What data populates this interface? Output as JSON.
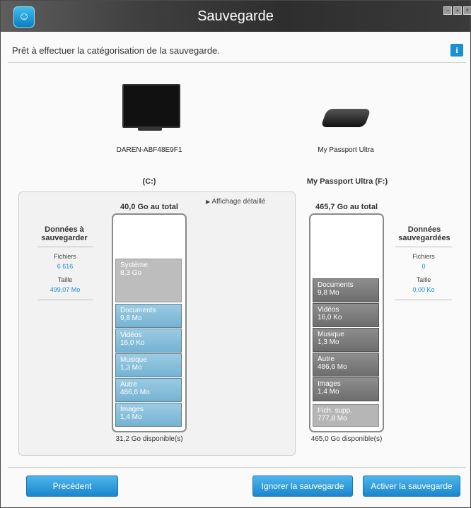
{
  "window": {
    "title": "Sauvegarde"
  },
  "status": {
    "text": "Prêt à effectuer la catégorisation de la sauvegarde."
  },
  "devices": {
    "source_name": "DAREN-ABF48E9F1",
    "dest_name": "My Passport Ultra"
  },
  "left": {
    "drive_label": "(C:)",
    "total": "40,0 Go au total",
    "available": "31,2 Go disponible(s)",
    "detail_link": "Affichage détaillé",
    "system": {
      "name": "Système",
      "size": "8,3 Go"
    },
    "segments": [
      {
        "name": "Documents",
        "size": "9,8 Mo"
      },
      {
        "name": "Vidéos",
        "size": "16,0 Ko"
      },
      {
        "name": "Musique",
        "size": "1,3 Mo"
      },
      {
        "name": "Autre",
        "size": "486,6 Mo"
      },
      {
        "name": "Images",
        "size": "1,4 Mo"
      }
    ],
    "side": {
      "title": "Données à sauvegarder",
      "files_label": "Fichiers",
      "files_value": "6 616",
      "size_label": "Taille",
      "size_value": "499,07 Mo"
    }
  },
  "right": {
    "drive_label": "My Passport Ultra (F:)",
    "total": "465,7 Go au total",
    "available": "465,0 Go disponible(s)",
    "segments": [
      {
        "name": "Documents",
        "size": "9,8 Mo"
      },
      {
        "name": "Vidéos",
        "size": "16,0 Ko"
      },
      {
        "name": "Musique",
        "size": "1,3 Mo"
      },
      {
        "name": "Autre",
        "size": "486,6 Mo"
      },
      {
        "name": "Images",
        "size": "1,4 Mo"
      }
    ],
    "extra": {
      "name": "Fich. supp.",
      "size": "777,8 Mo"
    },
    "side": {
      "title": "Données sauvegardées",
      "files_label": "Fichiers",
      "files_value": "0",
      "size_label": "Taille",
      "size_value": "0,00 Ko"
    }
  },
  "buttons": {
    "previous": "Précédent",
    "skip": "Ignorer la sauvegarde",
    "enable": "Activer la sauvegarde"
  },
  "colors": {
    "accent": "#1a86cc",
    "link": "#1b8fcf"
  }
}
